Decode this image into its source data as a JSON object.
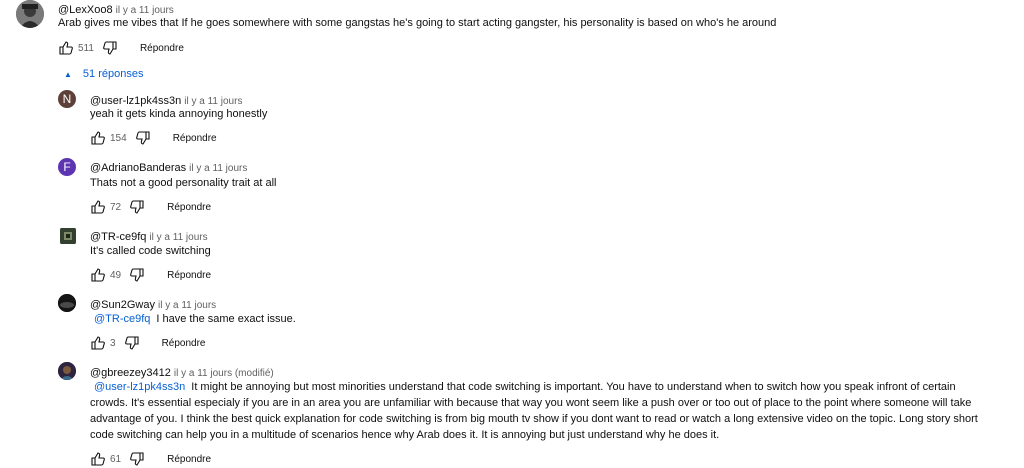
{
  "main_comment": {
    "author": "@LexXoo8",
    "time": "il y a 11 jours",
    "text": "Arab gives me vibes that If he goes somewhere with some gangstas he's going to start acting gangster, his personality is based on who's he around",
    "likes": "511",
    "reply_label": "Répondre"
  },
  "replies_toggle": {
    "label": "51 réponses"
  },
  "replies": [
    {
      "author": "@user-lz1pk4ss3n",
      "time": "il y a 11 jours",
      "avatar_letter": "N",
      "avatar_color": "#5d4037",
      "mention": "",
      "text": "yeah it gets kinda annoying honestly",
      "likes": "154",
      "reply_label": "Répondre"
    },
    {
      "author": "@AdrianoBanderas",
      "time": "il y a 11 jours",
      "avatar_letter": "F",
      "avatar_color": "#5e35b1",
      "mention": "",
      "text": "Thats not a good personality trait at all",
      "likes": "72",
      "reply_label": "Répondre"
    },
    {
      "author": "@TR-ce9fq",
      "time": "il y a 11 jours",
      "mention": "",
      "text": "It's called code switching",
      "likes": "49",
      "reply_label": "Répondre"
    },
    {
      "author": "@Sun2Gway",
      "time": "il y a 11 jours",
      "mention": "@TR-ce9fq",
      "text": "I have the same exact issue.",
      "likes": "3",
      "reply_label": "Répondre"
    },
    {
      "author": "@gbreezey3412",
      "time": "il y a 11 jours (modifié)",
      "mention": "@user-lz1pk4ss3n",
      "text_lines": [
        "It might be annoying but most minorities understand that code switching is important. You have to understand when to switch how you speak infront of certain",
        "crowds. It's essential especialy if you are in an area you are unfamiliar with because that way you wont seem like a push over or too out of place to the point where someone will take",
        "advantage of you. I think the best quick explanation for code switching is  from big mouth tv show if you dont want to read or watch a long extensive video on the topic. Long story short",
        "code switching can help you in a multitude of scenarios hence why Arab does it. It is annoying but just understand why he does it."
      ],
      "likes": "61",
      "reply_label": "Répondre"
    }
  ]
}
